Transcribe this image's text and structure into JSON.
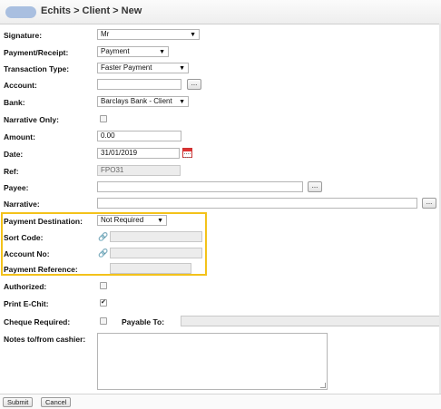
{
  "header": {
    "title": "Echits > Client > New"
  },
  "form": {
    "signature": {
      "label": "Signature:",
      "value": "Mr"
    },
    "payment_receipt": {
      "label": "Payment/Receipt:",
      "value": "Payment"
    },
    "transaction_type": {
      "label": "Transaction Type:",
      "value": "Faster Payment"
    },
    "account": {
      "label": "Account:",
      "value": "",
      "button": "..."
    },
    "bank": {
      "label": "Bank:",
      "value": "Barclays Bank - Client"
    },
    "narrative_only": {
      "label": "Narrative Only:",
      "checked": false
    },
    "amount": {
      "label": "Amount:",
      "value": "0.00"
    },
    "date": {
      "label": "Date:",
      "value": "31/01/2019"
    },
    "ref": {
      "label": "Ref:",
      "value": "FPO31"
    },
    "payee": {
      "label": "Payee:",
      "value": "",
      "button": "..."
    },
    "narrative": {
      "label": "Narrative:",
      "value": "",
      "button": "..."
    },
    "payment_destination": {
      "label": "Payment Destination:",
      "value": "Not Required"
    },
    "sort_code": {
      "label": "Sort Code:",
      "value": ""
    },
    "account_no": {
      "label": "Account No:",
      "value": ""
    },
    "payment_reference": {
      "label": "Payment Reference:",
      "value": ""
    },
    "authorized": {
      "label": "Authorized:",
      "checked": false
    },
    "print_echit": {
      "label": "Print E-Chit:",
      "checked": true
    },
    "cheque_required": {
      "label": "Cheque Required:",
      "checked": false
    },
    "payable_to": {
      "label": "Payable To:",
      "value": ""
    },
    "notes": {
      "label": "Notes to/from cashier:",
      "value": ""
    }
  },
  "footer": {
    "submit": "Submit",
    "cancel": "Cancel"
  },
  "icons": {
    "calendar": "calendar-icon",
    "link": "link-icon",
    "dropdown": "chevron-down-icon"
  },
  "colors": {
    "highlight": "#f3c21a",
    "title_pill": "#a9bfe0"
  }
}
